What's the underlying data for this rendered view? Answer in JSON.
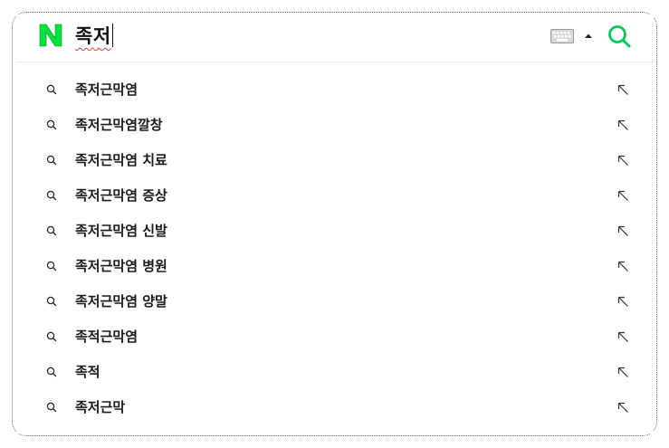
{
  "search": {
    "logo_letter": "N",
    "query": "족저",
    "brand_color": "#03c75a",
    "logo_color": "#00e33c"
  },
  "toolbar": {
    "keyboard_icon": "keyboard-icon",
    "toggle_icon": "caret-up-icon",
    "search_icon": "search-icon"
  },
  "suggestions": [
    {
      "label": "족저근막염"
    },
    {
      "label": "족저근막염깔창"
    },
    {
      "label": "족저근막염 치료"
    },
    {
      "label": "족저근막염 증상"
    },
    {
      "label": "족저근막염 신발"
    },
    {
      "label": "족저근막염 병원"
    },
    {
      "label": "족저근막염 양말"
    },
    {
      "label": "족적근막염"
    },
    {
      "label": "족적"
    },
    {
      "label": "족저근막"
    }
  ]
}
